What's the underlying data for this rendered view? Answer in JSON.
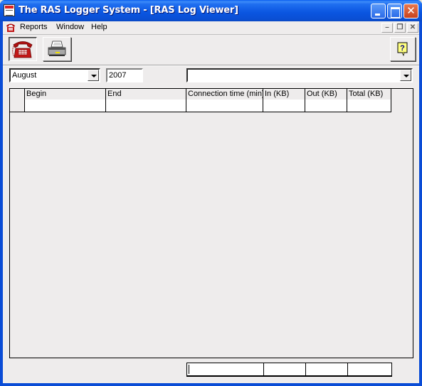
{
  "window": {
    "title": "The RAS Logger System - [RAS Log Viewer]"
  },
  "menu": {
    "items": [
      "Reports",
      "Window",
      "Help"
    ]
  },
  "toolbar": {
    "buttons": [
      {
        "name": "connection-log",
        "icon": "telephone-icon",
        "pressed": true
      },
      {
        "name": "print",
        "icon": "printer-icon",
        "pressed": false
      },
      {
        "name": "help",
        "icon": "help-icon",
        "pressed": false
      }
    ]
  },
  "filters": {
    "month": "August",
    "year": "2007",
    "connection": ""
  },
  "grid": {
    "columns": [
      "Begin",
      "End",
      "Connection time (min)",
      "In (KB)",
      "Out (KB)",
      "Total (KB)"
    ],
    "rows": [
      [
        "",
        "",
        "",
        "",
        "",
        ""
      ]
    ]
  },
  "totals": {
    "connection_time": "",
    "in": "",
    "out": "",
    "total": ""
  }
}
